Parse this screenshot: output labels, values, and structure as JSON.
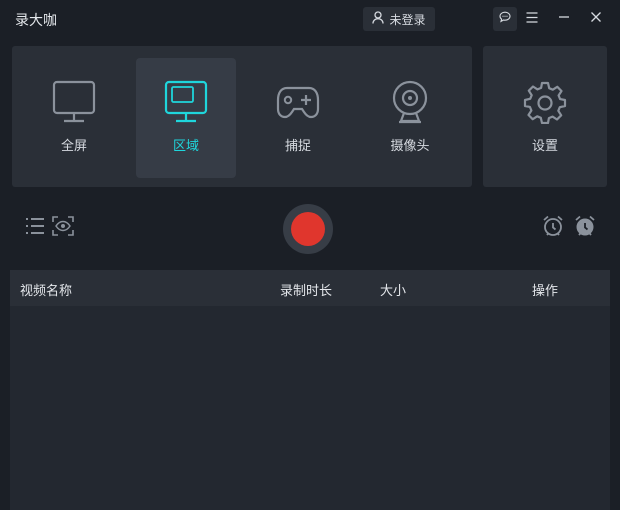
{
  "app": {
    "title": "录大咖"
  },
  "header": {
    "login_label": "未登录",
    "icons": [
      "user-icon",
      "chat-icon",
      "menu-icon",
      "minimize-icon",
      "close-icon"
    ]
  },
  "modes": [
    {
      "label": "全屏",
      "icon": "monitor-icon",
      "active": false
    },
    {
      "label": "区域",
      "icon": "region-monitor-icon",
      "active": true
    },
    {
      "label": "捕捉",
      "icon": "gamepad-icon",
      "active": false
    },
    {
      "label": "摄像头",
      "icon": "webcam-icon",
      "active": false
    }
  ],
  "settings": {
    "label": "设置",
    "icon": "gear-icon"
  },
  "controls": {
    "left_icons": [
      "list-icon",
      "preview-eye-icon"
    ],
    "record_icon": "record-icon",
    "right_icons": [
      "alarm-clock-icon",
      "alarm-clock-filled-icon"
    ]
  },
  "table": {
    "columns": [
      "视频名称",
      "录制时长",
      "大小",
      "操作"
    ],
    "rows": []
  },
  "colors": {
    "background": "#1b1f26",
    "panel": "#2a2f37",
    "active_tile": "#363c46",
    "accent": "#1fd6dc",
    "record": "#e0362d",
    "icon_gray": "#8b929c"
  }
}
